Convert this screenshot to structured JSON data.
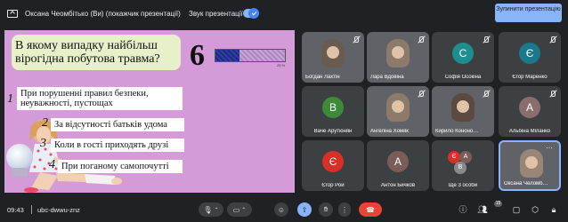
{
  "topbar": {
    "presenter_title": "Оксана Чеомбітько (Ви) (покажчик презентації)",
    "sound_label": "Звук презентації",
    "stop_button_label": "Зупинити презентацію",
    "sound_enabled": true
  },
  "slide": {
    "question": "В якому випадку найбільш вірогідна побутова травма?",
    "big_number": "6",
    "timer_progress": 0.35,
    "timer_pct_label": "25 %",
    "options": [
      {
        "num": "1",
        "text": "При порушенні правил безпеки, неуважності, пустощах"
      },
      {
        "num": "2",
        "text": "За відсутності батьків удома"
      },
      {
        "num": "3",
        "text": "Коли в гості приходять друзі"
      },
      {
        "num": "4",
        "text": "При поганому самопочутті"
      }
    ]
  },
  "participants": [
    {
      "name": "Богдан Лахтін",
      "type": "video",
      "muted": true
    },
    {
      "name": "Лара Вдовіна",
      "type": "video",
      "muted": true
    },
    {
      "name": "Софія Осокіна",
      "type": "avatar",
      "initial": "С",
      "color": "#1e8e8e",
      "muted": true
    },
    {
      "name": "Єгор Маренко",
      "type": "avatar",
      "initial": "Є",
      "color": "#1a7a8c",
      "muted": true
    },
    {
      "name": "Ваче Арутюнян",
      "type": "avatar",
      "initial": "В",
      "color": "#3d8b37",
      "muted": false
    },
    {
      "name": "Ангеліна Хомяк",
      "type": "video",
      "muted": true
    },
    {
      "name": "Кирило Кононо…",
      "type": "video",
      "muted": true
    },
    {
      "name": "Альбіна Міланко",
      "type": "avatar",
      "initial": "А",
      "color": "#8a6d6d",
      "muted": true
    },
    {
      "name": "Єгор Рой",
      "type": "avatar",
      "initial": "Є",
      "color": "#d93025",
      "muted": false
    },
    {
      "name": "Антон Бичков",
      "type": "avatar",
      "initial": "А",
      "color": "#7a5d58",
      "muted": false
    },
    {
      "name": "Ще 3 особи",
      "type": "group",
      "muted": false
    },
    {
      "name": "Оксана Челомб…",
      "type": "video",
      "muted": false,
      "active": true
    }
  ],
  "group_avatars": [
    {
      "initial": "Є",
      "color": "#d93025"
    },
    {
      "initial": "А",
      "color": "#7a5d58"
    },
    {
      "initial": "В",
      "color": "#8a8a8a"
    }
  ],
  "bottombar": {
    "time": "09:43",
    "meeting_code": "ubc-dwwu-znz",
    "participants_count": "15",
    "icons": [
      "mic-icon",
      "camera-icon",
      "emoji-icon",
      "present-icon",
      "raise-hand-icon",
      "more-icon",
      "end-call-icon",
      "info-icon",
      "people-icon",
      "chat-icon",
      "activities-icon",
      "lock-icon"
    ]
  }
}
